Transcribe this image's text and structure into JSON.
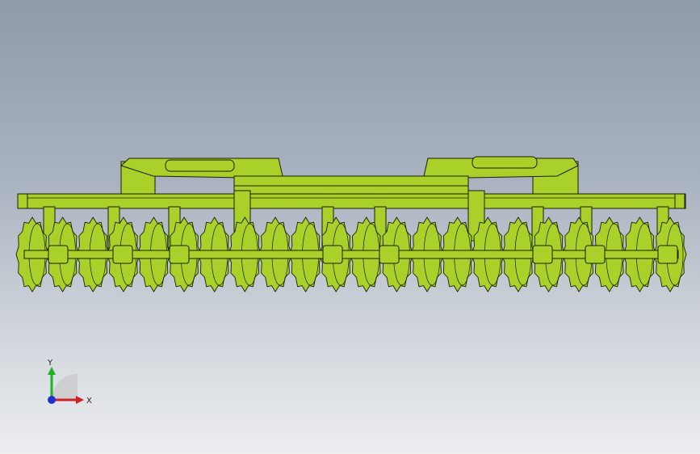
{
  "viewport": {
    "background_top": "#8e9bab",
    "background_bottom": "#eceef0",
    "model_color": "#a9d12a",
    "edge_color": "#1a1f05"
  },
  "model": {
    "description_icon": "disc-harrow-3d-model",
    "disc_count": 22
  },
  "triad": {
    "x_label": "X",
    "y_label": "Y",
    "x_color": "#d42020",
    "y_color": "#20b020",
    "z_color": "#2030d0"
  }
}
